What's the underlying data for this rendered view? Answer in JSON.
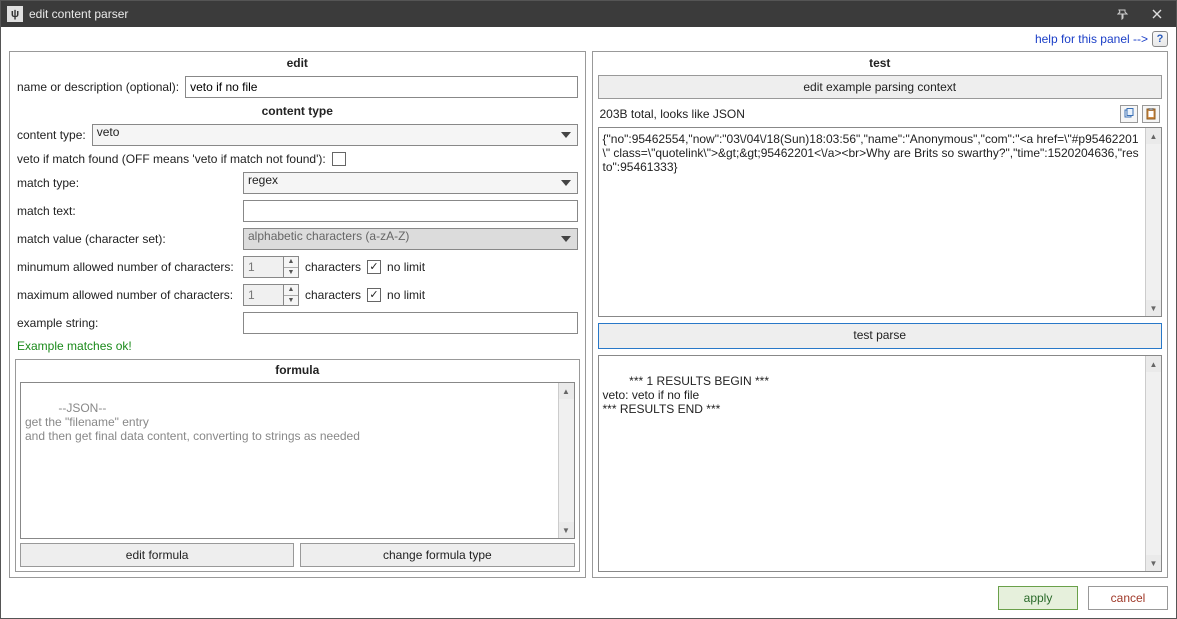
{
  "window": {
    "title": "edit content parser",
    "icon_glyph": "ψ"
  },
  "help": {
    "link_text": "help for this panel -->",
    "icon_label": "?"
  },
  "edit": {
    "title": "edit",
    "name_label": "name or description (optional):",
    "name_value": "veto if no file",
    "content_type_title": "content type",
    "content_type_label": "content type:",
    "content_type_value": "veto",
    "veto_toggle_label": "veto if match found (OFF means 'veto if match not found'):",
    "veto_toggle_checked": false,
    "match_type_label": "match type:",
    "match_type_value": "regex",
    "match_text_label": "match text:",
    "match_text_value": "",
    "match_value_label": "match value (character set):",
    "match_value_value": "alphabetic characters (a-zA-Z)",
    "min_chars_label": "minumum allowed number of characters:",
    "min_chars_value": "1",
    "min_chars_unit": "characters",
    "min_no_limit_label": "no limit",
    "min_no_limit_checked": true,
    "max_chars_label": "maximum allowed number of characters:",
    "max_chars_value": "1",
    "max_chars_unit": "characters",
    "max_no_limit_label": "no limit",
    "max_no_limit_checked": true,
    "example_string_label": "example string:",
    "example_string_value": "",
    "example_result": "Example matches ok!"
  },
  "formula": {
    "title": "formula",
    "body": "--JSON--\nget the \"filename\" entry\nand then get final data content, converting to strings as needed",
    "edit_btn": "edit formula",
    "change_btn": "change formula type"
  },
  "test": {
    "title": "test",
    "context_btn": "edit example parsing context",
    "status": "203B total, looks like JSON",
    "sample_text": "{\"no\":95462554,\"now\":\"03\\/04\\/18(Sun)18:03:56\",\"name\":\"Anonymous\",\"com\":\"<a href=\\\"#p95462201\\\" class=\\\"quotelink\\\">&gt;&gt;95462201<\\/a><br>Why are Brits so swarthy?\",\"time\":1520204636,\"resto\":95461333}",
    "parse_btn": "test parse",
    "results": "*** 1 RESULTS BEGIN ***\nveto: veto if no file\n*** RESULTS END ***"
  },
  "footer": {
    "apply": "apply",
    "cancel": "cancel"
  }
}
